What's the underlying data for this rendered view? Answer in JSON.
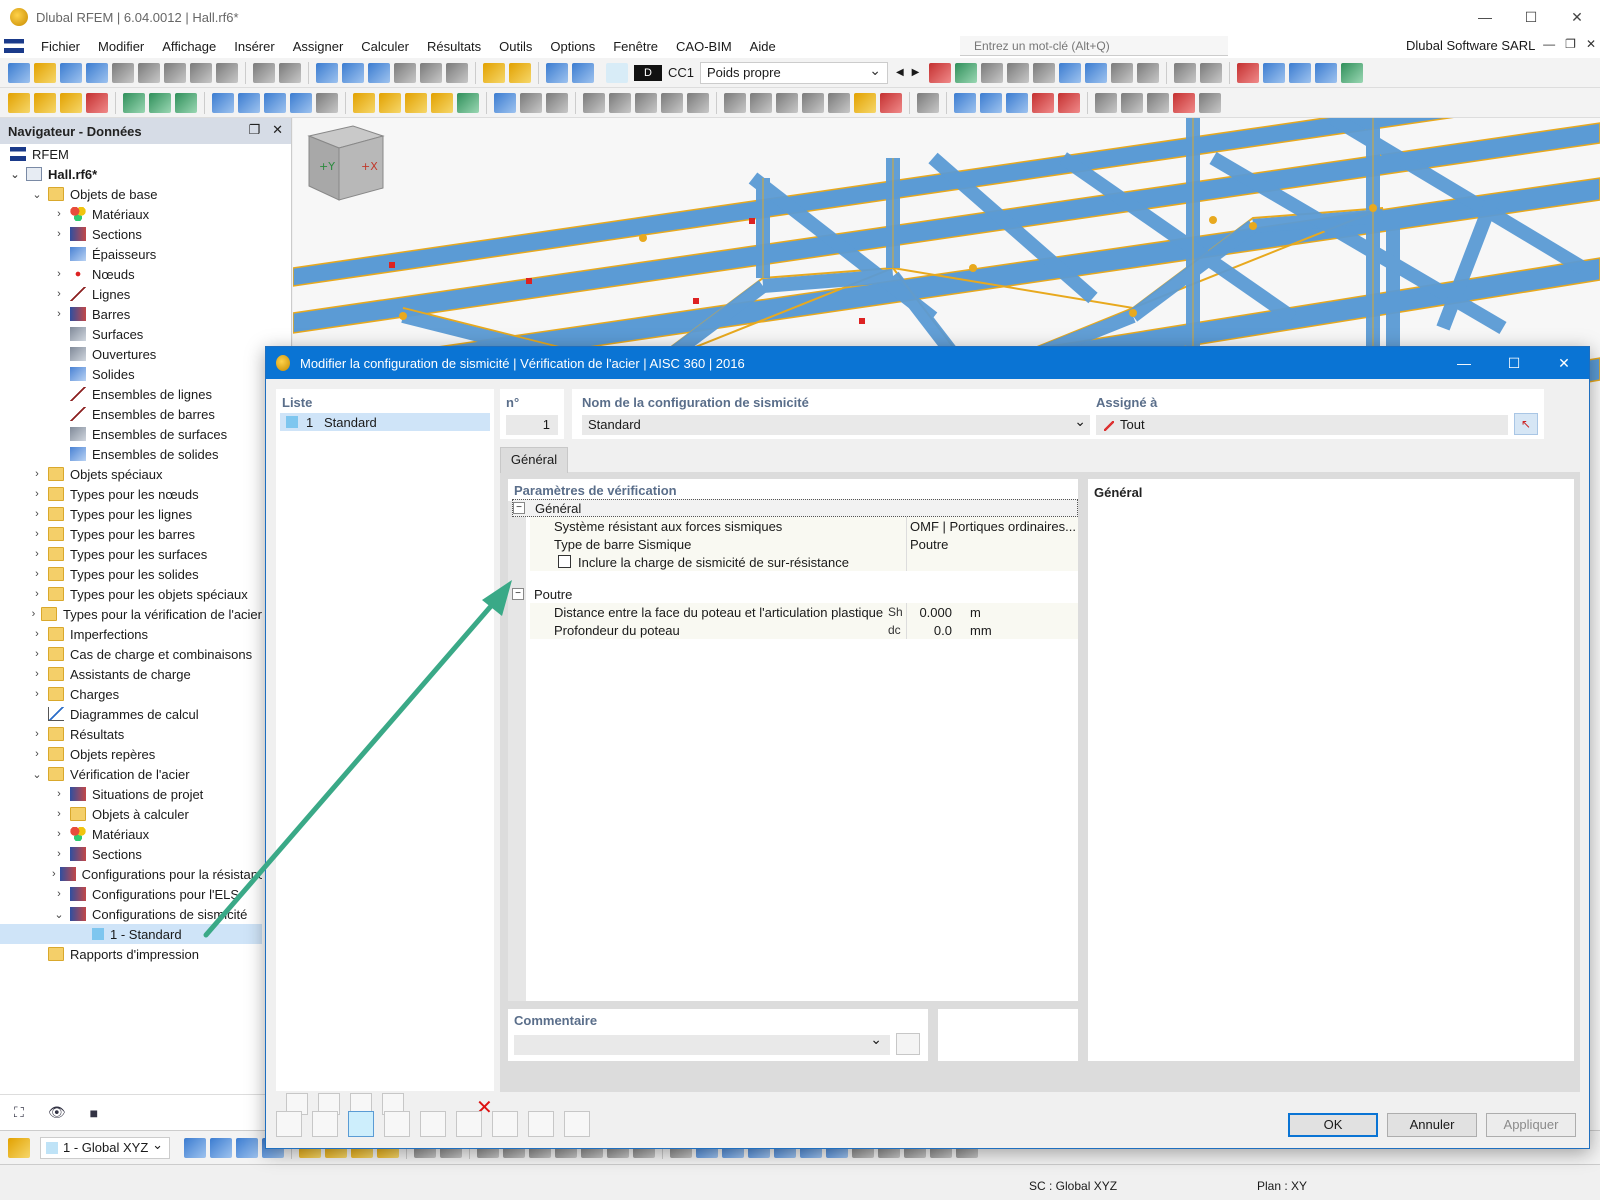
{
  "window": {
    "title": "Dlubal RFEM | 6.04.0012 | Hall.rf6*",
    "minimize": "—",
    "maximize": "☐",
    "close": "✕"
  },
  "menu": {
    "items": [
      "Fichier",
      "Modifier",
      "Affichage",
      "Insérer",
      "Assigner",
      "Calculer",
      "Résultats",
      "Outils",
      "Options",
      "Fenêtre",
      "CAO-BIM",
      "Aide"
    ],
    "search_placeholder": "Entrez un mot-clé (Alt+Q)",
    "company": "Dlubal Software SARL"
  },
  "toolbar": {
    "load_case_tag": "D",
    "load_case_id": "CC1",
    "load_case_name": "Poids propre"
  },
  "navigator": {
    "title": "Navigateur - Données",
    "root": "RFEM",
    "file": "Hall.rf6*",
    "items": [
      {
        "label": "Objets de base",
        "level": 1,
        "icon": "folder",
        "exp": "v"
      },
      {
        "label": "Matériaux",
        "level": 2,
        "icon": "mat",
        "exp": ">"
      },
      {
        "label": "Sections",
        "level": 2,
        "icon": "sec",
        "exp": ">"
      },
      {
        "label": "Épaisseurs",
        "level": 2,
        "icon": "blue",
        "exp": ""
      },
      {
        "label": "Nœuds",
        "level": 2,
        "icon": "dot",
        "exp": ">"
      },
      {
        "label": "Lignes",
        "level": 2,
        "icon": "line",
        "exp": ">"
      },
      {
        "label": "Barres",
        "level": 2,
        "icon": "sec",
        "exp": ">"
      },
      {
        "label": "Surfaces",
        "level": 2,
        "icon": "gray",
        "exp": ""
      },
      {
        "label": "Ouvertures",
        "level": 2,
        "icon": "gray",
        "exp": ""
      },
      {
        "label": "Solides",
        "level": 2,
        "icon": "blue",
        "exp": ""
      },
      {
        "label": "Ensembles de lignes",
        "level": 2,
        "icon": "line",
        "exp": ""
      },
      {
        "label": "Ensembles de barres",
        "level": 2,
        "icon": "line",
        "exp": ""
      },
      {
        "label": "Ensembles de surfaces",
        "level": 2,
        "icon": "gray",
        "exp": ""
      },
      {
        "label": "Ensembles de solides",
        "level": 2,
        "icon": "blue",
        "exp": ""
      },
      {
        "label": "Objets spéciaux",
        "level": 1,
        "icon": "folder",
        "exp": ">"
      },
      {
        "label": "Types pour les nœuds",
        "level": 1,
        "icon": "folder",
        "exp": ">"
      },
      {
        "label": "Types pour les lignes",
        "level": 1,
        "icon": "folder",
        "exp": ">"
      },
      {
        "label": "Types pour les barres",
        "level": 1,
        "icon": "folder",
        "exp": ">"
      },
      {
        "label": "Types pour les surfaces",
        "level": 1,
        "icon": "folder",
        "exp": ">"
      },
      {
        "label": "Types pour les solides",
        "level": 1,
        "icon": "folder",
        "exp": ">"
      },
      {
        "label": "Types pour les objets spéciaux",
        "level": 1,
        "icon": "folder",
        "exp": ">"
      },
      {
        "label": "Types pour la vérification de l'acier",
        "level": 1,
        "icon": "folder",
        "exp": ">"
      },
      {
        "label": "Imperfections",
        "level": 1,
        "icon": "folder",
        "exp": ">"
      },
      {
        "label": "Cas de charge et combinaisons",
        "level": 1,
        "icon": "folder",
        "exp": ">"
      },
      {
        "label": "Assistants de charge",
        "level": 1,
        "icon": "folder",
        "exp": ">"
      },
      {
        "label": "Charges",
        "level": 1,
        "icon": "folder",
        "exp": ">"
      },
      {
        "label": "Diagrammes de calcul",
        "level": 1,
        "icon": "diag",
        "exp": ""
      },
      {
        "label": "Résultats",
        "level": 1,
        "icon": "folder",
        "exp": ">"
      },
      {
        "label": "Objets repères",
        "level": 1,
        "icon": "folder",
        "exp": ">"
      },
      {
        "label": "Vérification de l'acier",
        "level": 1,
        "icon": "folder",
        "exp": "v"
      },
      {
        "label": "Situations de projet",
        "level": 2,
        "icon": "sec",
        "exp": ">"
      },
      {
        "label": "Objets à calculer",
        "level": 2,
        "icon": "b",
        "exp": ">"
      },
      {
        "label": "Matériaux",
        "level": 2,
        "icon": "mat",
        "exp": ">"
      },
      {
        "label": "Sections",
        "level": 2,
        "icon": "sec",
        "exp": ">"
      },
      {
        "label": "Configurations pour la résistance",
        "level": 2,
        "icon": "sec",
        "exp": ">"
      },
      {
        "label": "Configurations pour l'ELS",
        "level": 2,
        "icon": "sec",
        "exp": ">"
      },
      {
        "label": "Configurations de sismicité",
        "level": 2,
        "icon": "sec",
        "exp": "v"
      },
      {
        "label": "1 - Standard",
        "level": 3,
        "icon": "sel",
        "exp": "",
        "selected": true
      },
      {
        "label": "Rapports d'impression",
        "level": 1,
        "icon": "folder",
        "exp": ""
      }
    ]
  },
  "statusbar": {
    "view": "1 - Global XYZ",
    "sc": "SC : Global XYZ",
    "plan": "Plan : XY"
  },
  "dialog": {
    "title": "Modifier la configuration de sismicité | Vérification de l'acier | AISC 360 | 2016",
    "list_label": "Liste",
    "list_items": [
      {
        "no": "1",
        "name": "Standard"
      }
    ],
    "no_label": "n°",
    "no_value": "1",
    "name_label": "Nom de la configuration de sismicité",
    "name_value": "Standard",
    "assigned_label": "Assigné à",
    "assigned_value": "Tout",
    "tab": "Général",
    "params_label": "Paramètres de vérification",
    "groups": {
      "general": {
        "title": "Général",
        "rows": [
          {
            "label": "Système résistant aux forces sismiques",
            "value": "OMF | Portiques ordinaires..."
          },
          {
            "label": "Type de barre Sismique",
            "value": "Poutre"
          },
          {
            "label": "Inclure la charge de sismicité de sur-résistance",
            "checked": false
          }
        ]
      },
      "beam": {
        "title": "Poutre",
        "rows": [
          {
            "label": "Distance entre la face du poteau et l'articulation plastique",
            "symbol": "Sh",
            "value": "0.000",
            "unit": "m"
          },
          {
            "label": "Profondeur du poteau",
            "symbol": "dc",
            "value": "0.0",
            "unit": "mm"
          }
        ]
      }
    },
    "right_title": "Général",
    "comment_label": "Commentaire",
    "comment_value": "",
    "ok": "OK",
    "cancel": "Annuler",
    "apply": "Appliquer"
  },
  "colors": {
    "accent": "#0a74d4",
    "beam": "#5b9bd5",
    "beam_outline": "#e8a91e",
    "arrow": "#3aa987"
  }
}
